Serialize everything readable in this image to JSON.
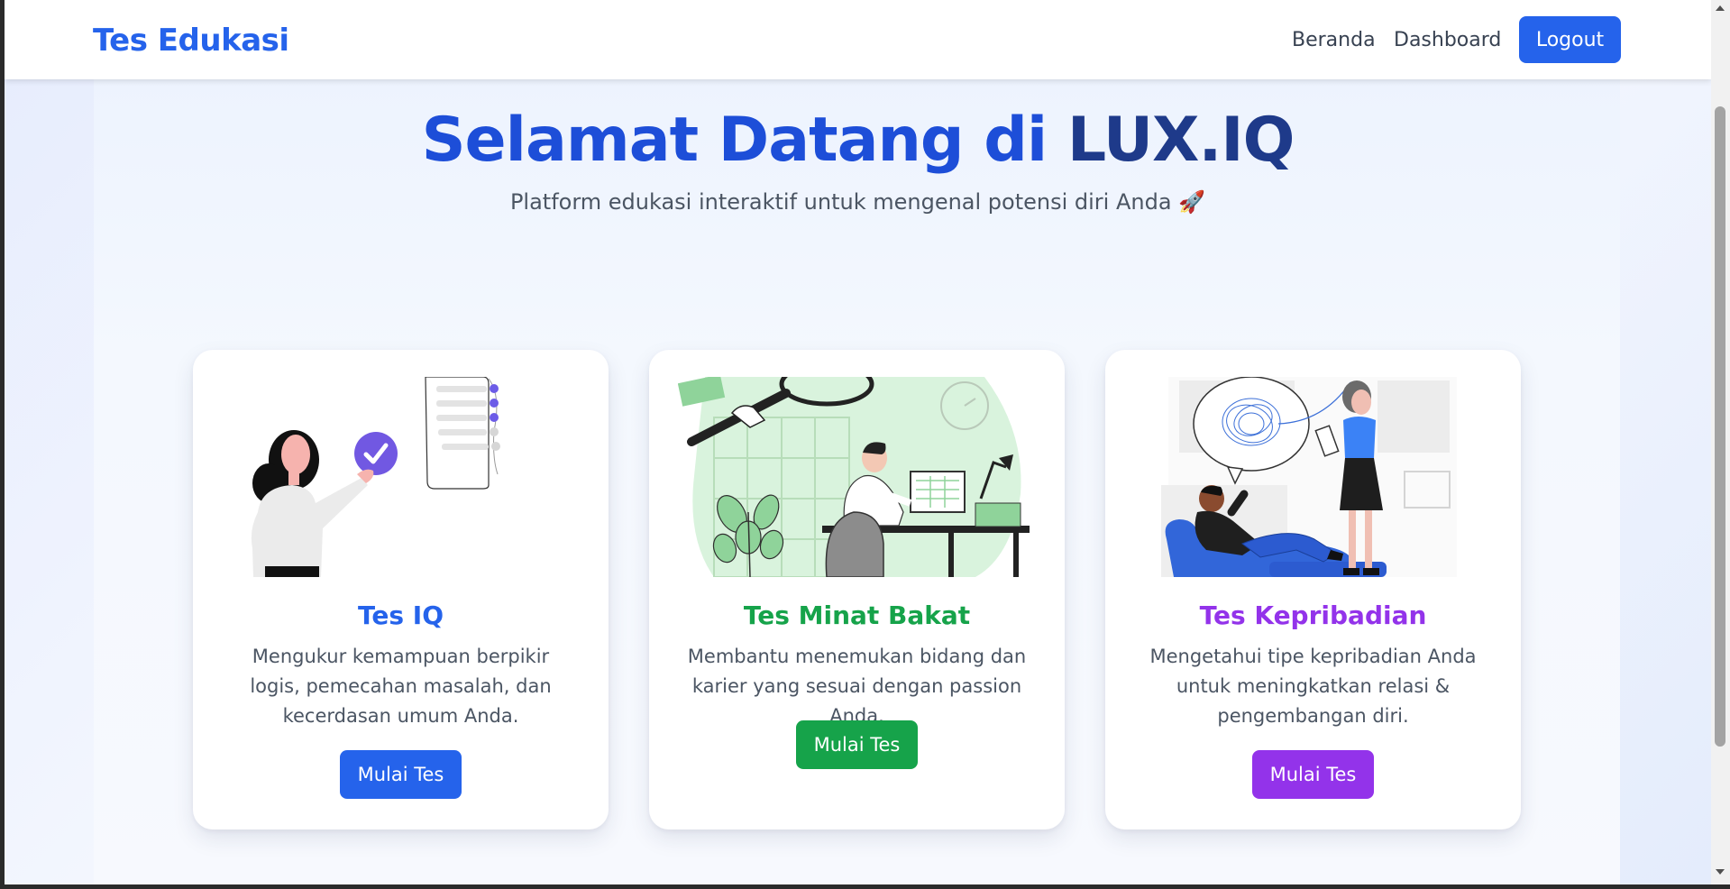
{
  "navbar": {
    "brand": "Tes Edukasi",
    "links": [
      "Beranda",
      "Dashboard"
    ],
    "logout_label": "Logout"
  },
  "hero": {
    "title_prefix": "Selamat Datang di ",
    "title_brand": "LUX.IQ",
    "subtitle": "Platform edukasi interaktif untuk mengenal potensi diri Anda 🚀"
  },
  "cards": [
    {
      "title": "Tes IQ",
      "description": "Mengukur kemampuan berpikir logis, pemecahan masalah, dan kecerdasan umum Anda.",
      "button": "Mulai Tes",
      "accent": "#2563eb"
    },
    {
      "title": "Tes Minat Bakat",
      "description": "Membantu menemukan bidang dan karier yang sesuai dengan passion Anda.",
      "button": "Mulai Tes",
      "accent": "#16a34a"
    },
    {
      "title": "Tes Kepribadian",
      "description": "Mengetahui tipe kepribadian Anda untuk meningkatkan relasi & pengembangan diri.",
      "button": "Mulai Tes",
      "accent": "#9333ea"
    }
  ],
  "colors": {
    "primary": "#2563eb",
    "success": "#16a34a",
    "purple": "#9333ea"
  }
}
